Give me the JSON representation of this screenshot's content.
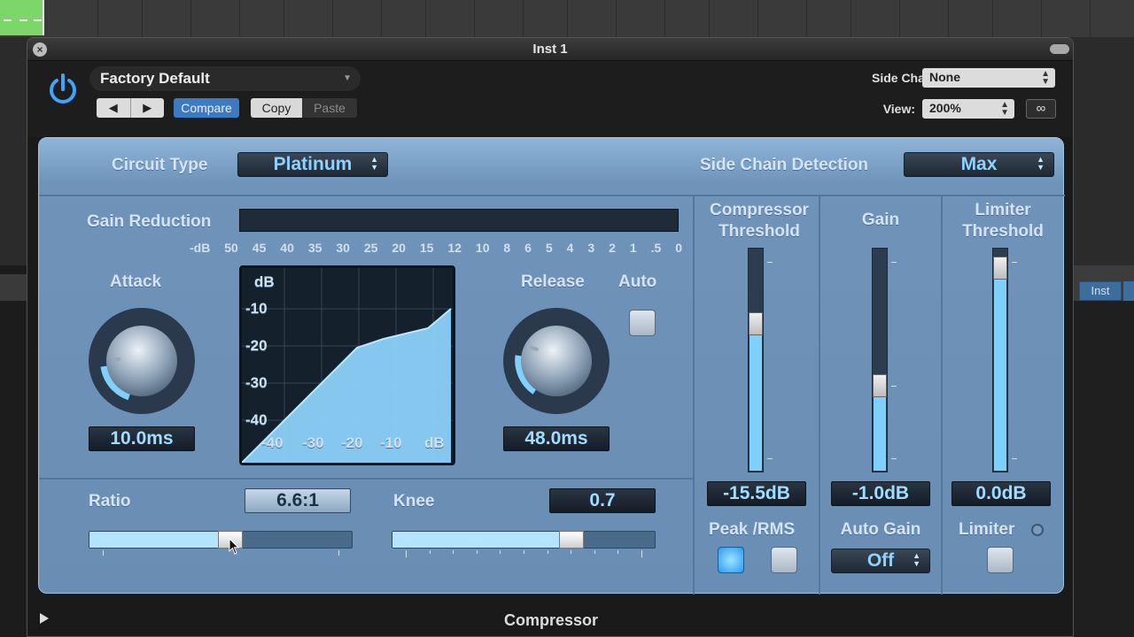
{
  "daw": {
    "inst_tab": "Inst"
  },
  "window": {
    "title": "Inst 1",
    "close_icon": "close-icon"
  },
  "header": {
    "preset": "Factory Default",
    "nav_prev": "◀",
    "nav_next": "▶",
    "compare": "Compare",
    "copy": "Copy",
    "paste": "Paste",
    "side_chain_label": "Side Chain:",
    "side_chain_value": "None",
    "view_label": "View:",
    "view_value": "200%",
    "link_icon": "link-icon"
  },
  "panel": {
    "circuit_type_label": "Circuit Type",
    "circuit_type_value": "Platinum",
    "sidechain_detect_label": "Side Chain Detection",
    "sidechain_detect_value": "Max",
    "gain_reduction_label": "Gain Reduction",
    "gr_scale": [
      "-dB",
      "50",
      "45",
      "40",
      "35",
      "30",
      "25",
      "20",
      "15",
      "12",
      "10",
      "8",
      "6",
      "5",
      "4",
      "3",
      "2",
      "1",
      ".5",
      "0"
    ],
    "attack_label": "Attack",
    "attack_value": "10.0ms",
    "release_label": "Release",
    "release_value": "48.0ms",
    "auto_label": "Auto",
    "graph_y_labels": [
      "dB",
      "-10",
      "-20",
      "-30",
      "-40"
    ],
    "graph_x_labels": [
      "-40",
      "-30",
      "-20",
      "-10",
      "dB"
    ],
    "ratio_label": "Ratio",
    "ratio_value": "6.6:1",
    "ratio_level": 0.54,
    "knee_label": "Knee",
    "knee_value": "0.7",
    "knee_level": 0.7,
    "comp_threshold_label_1": "Compressor",
    "comp_threshold_label_2": "Threshold",
    "comp_threshold_value": "-15.5dB",
    "comp_threshold_level": 0.68,
    "gain_label": "Gain",
    "gain_value": "-1.0dB",
    "gain_level": 0.37,
    "limiter_threshold_label_1": "Limiter",
    "limiter_threshold_label_2": "Threshold",
    "limiter_threshold_value": "0.0dB",
    "limiter_threshold_level": 0.96,
    "peak_rms_label": "Peak /RMS",
    "auto_gain_label": "Auto Gain",
    "auto_gain_value": "Off",
    "limiter_label": "Limiter"
  },
  "footer": {
    "plugin_name": "Compressor"
  },
  "colors": {
    "accent": "#7fcfff",
    "panel": "#6f93b9",
    "compare_active": "#3d7ac2"
  }
}
